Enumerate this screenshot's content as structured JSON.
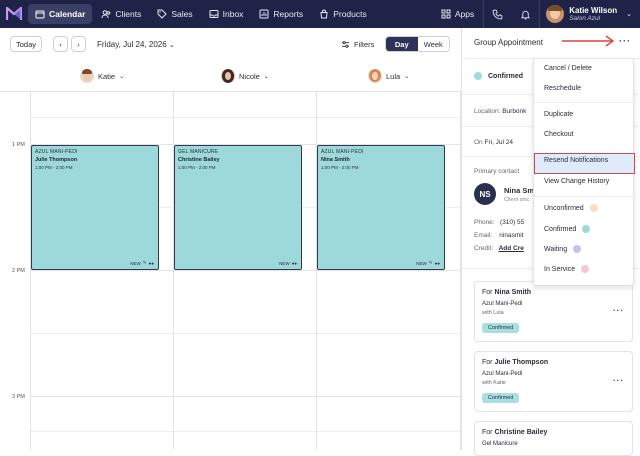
{
  "nav": {
    "items": [
      {
        "label": "Calendar",
        "icon": "calendar-icon",
        "active": true
      },
      {
        "label": "Clients",
        "icon": "users-icon"
      },
      {
        "label": "Sales",
        "icon": "tag-icon"
      },
      {
        "label": "Inbox",
        "icon": "inbox-icon"
      },
      {
        "label": "Reports",
        "icon": "chart-icon"
      },
      {
        "label": "Products",
        "icon": "bag-icon"
      }
    ],
    "apps_label": "Apps",
    "user_name": "Katie Wilson",
    "user_sub": "Salon Azul"
  },
  "toolbar": {
    "today_label": "Today",
    "date_label": "Friday, Jul 24, 2026",
    "filters_label": "Filters",
    "view_day": "Day",
    "view_week": "Week"
  },
  "staff": [
    {
      "name": "Katie"
    },
    {
      "name": "Nicole"
    },
    {
      "name": "Lula"
    }
  ],
  "times": [
    "1 PM",
    "2 PM",
    "3 PM"
  ],
  "appointments": [
    {
      "service": "AZUL MANI-PEDI",
      "client": "Julie Thompson",
      "time": "1:00 PM - 2:00 PM",
      "tag": "NEW"
    },
    {
      "service": "GEL MANICURE",
      "client": "Christine Bailey",
      "time": "1:00 PM - 2:00 PM",
      "tag": "NEW"
    },
    {
      "service": "AZUL MANI-PEDI",
      "client": "Nina Smith",
      "time": "1:00 PM - 2:00 PM",
      "tag": "NEW"
    }
  ],
  "panel": {
    "title": "Group Appointment",
    "status": "Confirmed",
    "location_label": "Location:",
    "location_value": "Burbonk",
    "on_label": "On",
    "on_value": "Fri, Jul 24",
    "primary_contact": "Primary contact",
    "contact_initials": "NS",
    "contact_name": "Nina Sm",
    "contact_since": "Client sinc",
    "phone_label": "Phone:",
    "phone_value": "(310) 55",
    "email_label": "Email:",
    "email_value": "ninasmit",
    "credit_label": "Credit:",
    "credit_value": "Add Cre",
    "cards": [
      {
        "for": "For",
        "name": "Nina Smith",
        "service": "Azul Mani-Pedi",
        "with": "with Lula",
        "badge": "Confirmed"
      },
      {
        "for": "For",
        "name": "Julie Thompson",
        "service": "Azul Mani-Pedi",
        "with": "with Katie",
        "badge": "Confirmed"
      },
      {
        "for": "For",
        "name": "Christine Bailey",
        "service": "Gel Manicure"
      }
    ]
  },
  "menu": {
    "items": [
      "Cancel / Delete",
      "Reschedule",
      "Duplicate",
      "Checkout",
      "Resend Notifications",
      "View Change History",
      "Unconfirmed",
      "Confirmed",
      "Waiting",
      "In Service"
    ],
    "status_colors": {
      "unconfirmed": "#f7dcc0",
      "confirmed": "#9fdadb",
      "waiting": "#cdbdf0",
      "in_service": "#f6c6d6"
    }
  },
  "colors": {
    "nav_bg": "#1f2347",
    "appointment": "#9dd9db",
    "highlight_border": "#c74b50",
    "arrow": "#d9453f"
  }
}
